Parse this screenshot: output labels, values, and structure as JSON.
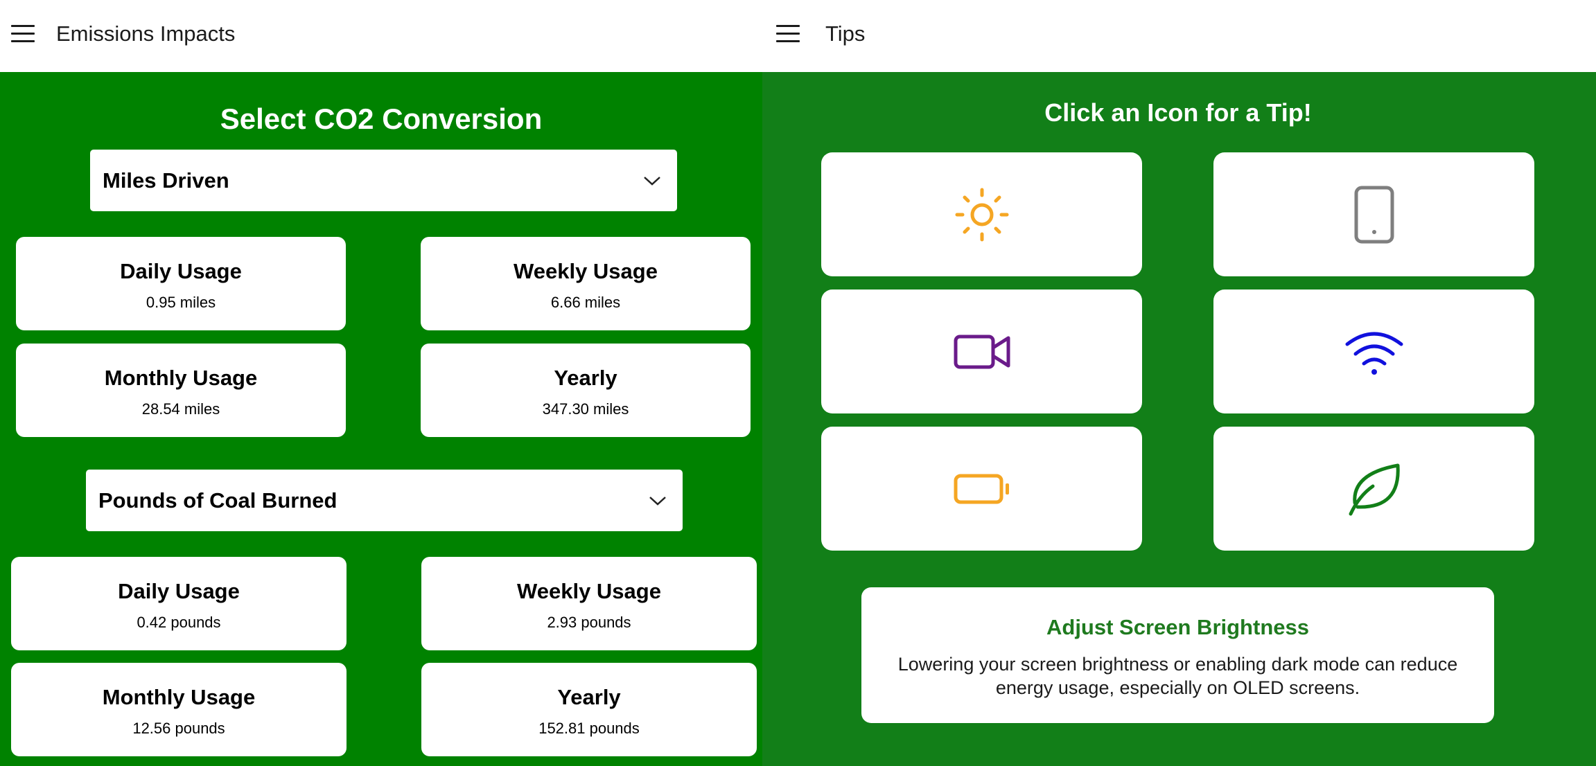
{
  "left_header": {
    "title": "Emissions Impacts"
  },
  "right_header": {
    "title": "Tips"
  },
  "left_panel": {
    "title": "Select CO2 Conversion",
    "sections": [
      {
        "dropdown": "Miles Driven",
        "cards": [
          {
            "title": "Daily Usage",
            "value": "0.95 miles"
          },
          {
            "title": "Weekly Usage",
            "value": "6.66 miles"
          },
          {
            "title": "Monthly Usage",
            "value": "28.54 miles"
          },
          {
            "title": "Yearly",
            "value": "347.30 miles"
          }
        ]
      },
      {
        "dropdown": "Pounds of Coal Burned",
        "cards": [
          {
            "title": "Daily Usage",
            "value": "0.42 pounds"
          },
          {
            "title": "Weekly Usage",
            "value": "2.93 pounds"
          },
          {
            "title": "Monthly Usage",
            "value": "12.56 pounds"
          },
          {
            "title": "Yearly",
            "value": "152.81 pounds"
          }
        ]
      }
    ]
  },
  "right_panel": {
    "title": "Click an Icon for a Tip!",
    "tip_icons": [
      {
        "icon": "sun-icon",
        "color": "#f5a623"
      },
      {
        "icon": "phone-icon",
        "color": "#7f7f7f"
      },
      {
        "icon": "video-camera-icon",
        "color": "#6a1b8a"
      },
      {
        "icon": "wifi-icon",
        "color": "#1111dd"
      },
      {
        "icon": "battery-icon",
        "color": "#f5a623"
      },
      {
        "icon": "leaf-icon",
        "color": "#127f18"
      }
    ],
    "tip": {
      "title": "Adjust Screen Brightness",
      "text": "Lowering your screen brightness or enabling dark mode can reduce energy usage, especially on OLED screens."
    }
  },
  "colors": {
    "left_panel_bg": "#008200",
    "right_panel_bg": "#127f18",
    "tip_title": "#1f7a1f"
  }
}
